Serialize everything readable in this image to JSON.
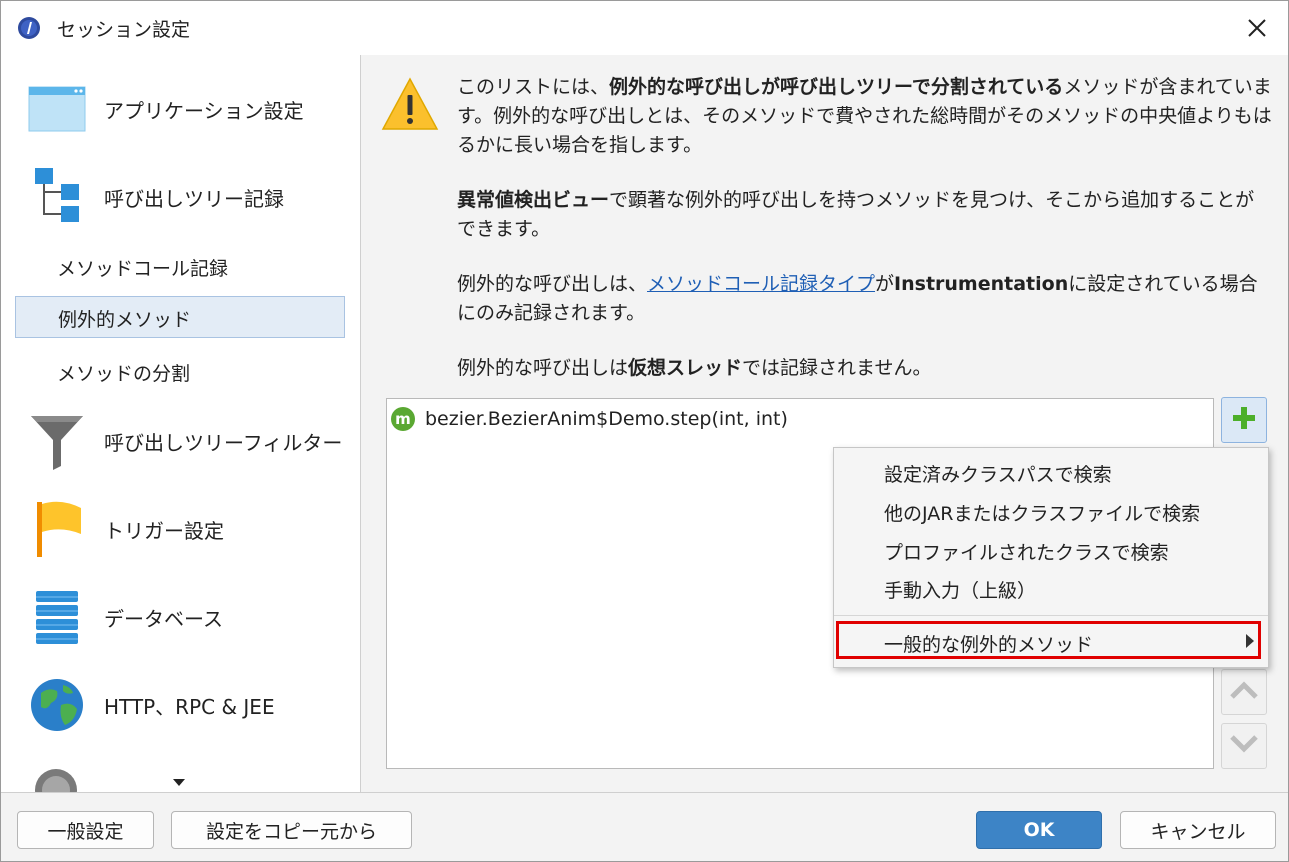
{
  "window": {
    "title": "セッション設定"
  },
  "sidebar": {
    "items": [
      {
        "label": "アプリケーション設定",
        "icon": "application-window-icon"
      },
      {
        "label": "呼び出しツリー記録",
        "icon": "call-tree-icon"
      },
      {
        "label": "メソッドコール記録",
        "sub": true
      },
      {
        "label": "例外的メソッド",
        "sub": true,
        "selected": true
      },
      {
        "label": "メソッドの分割",
        "sub": true
      },
      {
        "label": "呼び出しツリーフィルター",
        "icon": "funnel-icon"
      },
      {
        "label": "トリガー設定",
        "icon": "flag-icon"
      },
      {
        "label": "データベース",
        "icon": "database-icon"
      },
      {
        "label": "HTTP、RPC & JEE",
        "icon": "globe-icon"
      }
    ]
  },
  "info": {
    "p1_pre": "このリストには、",
    "p1_bold": "例外的な呼び出しが呼び出しツリーで分割されている",
    "p1_post": "メソッドが含まれています。例外的な呼び出しとは、そのメソッドで費やされた総時間がそのメソッドの中央値よりもはるかに長い場合を指します。",
    "p2_bold": "異常値検出ビュー",
    "p2_post": "で顕著な例外的呼び出しを持つメソッドを見つけ、そこから追加することができます。",
    "p3_pre": "例外的な呼び出しは、",
    "p3_link": "メソッドコール記録タイプ",
    "p3_mid": "が",
    "p3_bold": "Instrumentation",
    "p3_post": "に設定されている場合にのみ記録されます。",
    "p4_pre": "例外的な呼び出しは",
    "p4_bold": "仮想スレッド",
    "p4_post": "では記録されません。"
  },
  "list": {
    "rows": [
      {
        "badge": "m",
        "text": "bezier.BezierAnim$Demo.step(int, int)"
      }
    ]
  },
  "popup": {
    "items": [
      "設定済みクラスパスで検索",
      "他のJARまたはクラスファイルで検索",
      "プロファイルされたクラスで検索",
      "手動入力（上級）"
    ],
    "submenu": "一般的な例外的メソッド"
  },
  "buttons": {
    "general": "一般設定",
    "copy": "設定をコピー元から",
    "ok": "OK",
    "cancel": "キャンセル"
  },
  "colors": {
    "accent": "#3d84c6",
    "highlight": "#e00000",
    "selection": "#e3ecf6",
    "method_badge": "#5aa832",
    "add_icon": "#4caf2a"
  }
}
